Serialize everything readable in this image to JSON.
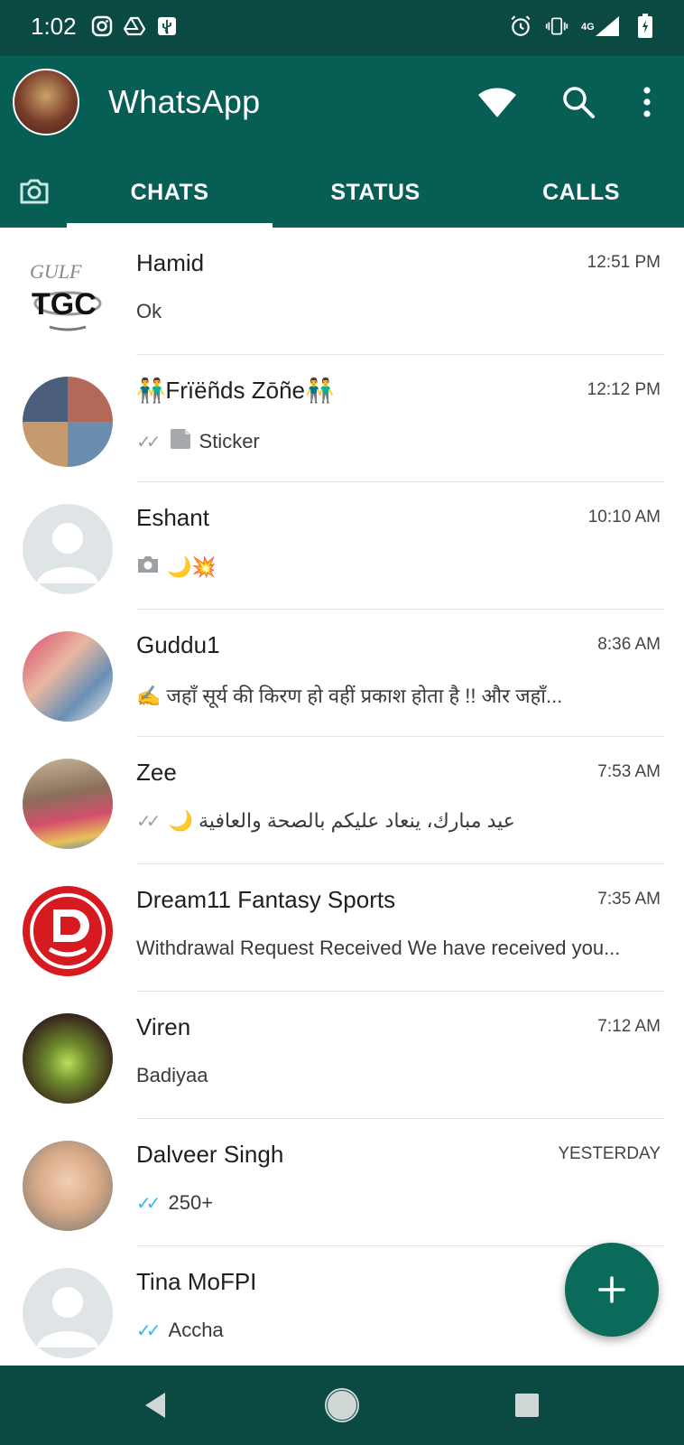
{
  "statusbar": {
    "time": "1:02",
    "left_icons": [
      "instagram-icon",
      "drive-icon",
      "usb-icon"
    ],
    "right_icons": [
      "alarm-icon",
      "vibrate-icon",
      "signal-4g-icon",
      "battery-icon"
    ],
    "network_label": "4G"
  },
  "appbar": {
    "title": "WhatsApp",
    "actions": [
      "wifi-icon",
      "search-icon",
      "overflow-menu-icon"
    ],
    "accent_color": "#075e54"
  },
  "tabs": {
    "camera": "camera-icon",
    "chats": "CHATS",
    "status": "STATUS",
    "calls": "CALLS",
    "selected": "CHATS"
  },
  "chats": [
    {
      "name": "Hamid",
      "time": "12:51 PM",
      "preview": "Ok",
      "avatar": "tgc-logo"
    },
    {
      "name": "👬Frïëñds Zōñe👬",
      "time": "12:12 PM",
      "preview": "Sticker",
      "status": "read-grey",
      "avatar": "group-photo"
    },
    {
      "name": "Eshant",
      "time": "10:10 AM",
      "preview": "🌙💥",
      "avatar": "default"
    },
    {
      "name": "Guddu1",
      "time": "8:36 AM",
      "preview": "✍️   जहाँ सूर्य की किरण हो वहीं प्रकाश होता है !!          और  जहाँ...",
      "avatar": "photo"
    },
    {
      "name": "Zee",
      "time": "7:53 AM",
      "preview": "🌙 عيد مبارك، ينعاد عليكم بالصحة والعافية",
      "status": "read-grey",
      "avatar": "photo"
    },
    {
      "name": "Dream11 Fantasy Sports",
      "time": "7:35 AM",
      "preview": "Withdrawal Request Received  We have received you...",
      "avatar": "dream11-logo"
    },
    {
      "name": "Viren",
      "time": "7:12 AM",
      "preview": "Badiyaa",
      "avatar": "photo"
    },
    {
      "name": "Dalveer Singh",
      "time": "YESTERDAY",
      "preview": "250+",
      "status": "read-blue",
      "avatar": "photo"
    },
    {
      "name": "Tina MoFPI",
      "time": "",
      "preview": "Accha",
      "status": "read-blue",
      "avatar": "default"
    }
  ],
  "fab": {
    "icon": "new-chat-icon",
    "label": "+"
  },
  "navbar": {
    "buttons": [
      "back-icon",
      "home-icon",
      "recents-icon"
    ]
  }
}
